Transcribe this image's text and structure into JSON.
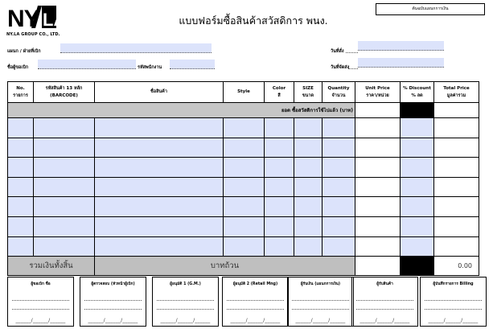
{
  "header": {
    "company": "NY.LA GROUP CO., LTD.",
    "title": "แบบฟอร์มซื้อสินค้าสวัสดิการ พนง.",
    "copy_box": "ต้นฉบับแผนกการเงิน"
  },
  "fields": {
    "department": "แผนก / ฝ่ายที่เบิก",
    "requester": "ชื่อผู้ขอเบิก",
    "employee_id": "รหัสพนักงาน",
    "order_date": "วันที่สั่ง",
    "ship_date": "วันที่จัดส่ง"
  },
  "table": {
    "headers": {
      "no_1": "No.",
      "no_2": "รายการ",
      "code_1": "รหัสสินค้า 13 หลัก",
      "code_2": "(BARCODE)",
      "name": "ชื่อสินค้า",
      "style": "Style",
      "color_1": "Color",
      "color_2": "สี",
      "size_1": "SIZE",
      "size_2": "ขนาด",
      "qty_1": "Quantity",
      "qty_2": "จำนวน",
      "price_1": "Unit Price",
      "price_2": "ราคา/หน่วย",
      "disc_1": "% Discount",
      "disc_2": "% ลด",
      "total_1": "Total Price",
      "total_2": "มูลค่ารวม"
    },
    "previous_label": "ยอด ซื้อสวัสดิการใช้ไปแล้ว (บาท)",
    "total_label": "รวมเงินทั้งสิ้น",
    "total_words": "บาทถ้วน",
    "total_amount": "0.00"
  },
  "signatures": [
    {
      "title": "ผู้ขอเบิก ชื่อ",
      "date": "______/______/______"
    },
    {
      "title": "ผู้ตรวจสอบ (หัวหน้าผู้เบิก)",
      "date": "______/______/______"
    },
    {
      "title": "ผู้อนุมัติ 1 (G.M.)",
      "date": "______/______/______"
    },
    {
      "title": "ผู้อนุมัติ 2 (Retail Mng)",
      "date": "______/______/______"
    },
    {
      "title": "ผู้รับเงิน (แผนกการเงิน)",
      "date": "______/______/______"
    },
    {
      "title": "ผู้รับสินค้า",
      "date": "______/______/______"
    },
    {
      "title": "ผู้บันทึกรายการ Billing",
      "date": "______/______/______"
    }
  ]
}
